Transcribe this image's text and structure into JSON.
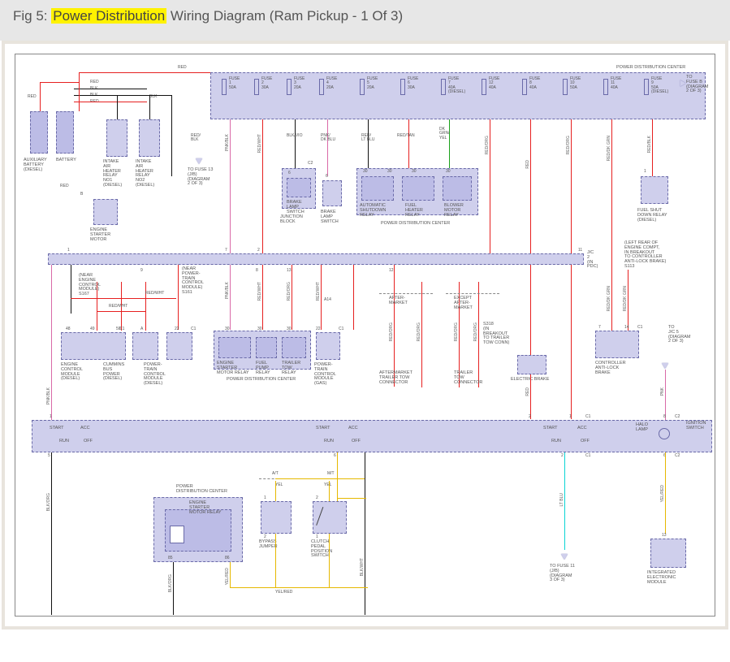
{
  "header": {
    "prefix": "Fig 5: ",
    "highlight": "Power Distribution",
    "suffix": " Wiring Diagram (Ram Pickup - 1 Of 3)"
  },
  "title_pdc": "POWER DISTRIBUTION CENTER",
  "to_fuse_b": "TO\nFUSE B\n(DIAGRAM\n2 OF 3)",
  "fuses": [
    {
      "n": "FUSE\n1",
      "a": "50A"
    },
    {
      "n": "FUSE\n2",
      "a": "30A"
    },
    {
      "n": "FUSE\n3",
      "a": "20A"
    },
    {
      "n": "FUSE\n4",
      "a": "20A"
    },
    {
      "n": "FUSE\n5",
      "a": "20A"
    },
    {
      "n": "FUSE\n6",
      "a": "30A"
    },
    {
      "n": "FUSE\n7",
      "a": "40A\n(DIESEL)"
    },
    {
      "n": "FUSE\n12",
      "a": "40A"
    },
    {
      "n": "FUSE\n8",
      "a": "40A"
    },
    {
      "n": "FUSE\n10",
      "a": "50A"
    },
    {
      "n": "FUSE\n11",
      "a": "40A"
    },
    {
      "n": "FUSE\n9",
      "a": "50A\n(DIESEL)"
    }
  ],
  "batteries": {
    "aux": "AUXILIARY\nBATTERY\n(DIESEL)",
    "main": "BATTERY"
  },
  "relays_top": {
    "ih1": "INTAKE\nAIR\nHEATER\nRELAY\nNO1\n(DIESEL)",
    "ih2": "INTAKE\nAIR\nHEATER\nRELAY\nNO2\n(DIESEL)",
    "starter": "ENGINE\nSTARTER\nMOTOR",
    "to_fuse13": "TO FUSE 13\n(J/B)\n(DIAGRAM\n2 OF 3)",
    "brake_lamp_sw": "BRAKE\nLAMP\nSWITCH",
    "junction_block": "JUNCTION\nBLOCK",
    "brake_lamp_sw2": "BRAKE\nLAMP\nSWITCH",
    "auto_shutdown": "AUTOMATIC\nSHUTDOWN\nRELAY",
    "fuel_heater": "FUEL\nHEATER\nRELAY",
    "blower": "BLOWER\nMOTOR\nRELAY",
    "pdc2": "POWER DISTRIBUTION CENTER",
    "fuel_shutdown": "FUEL SHUT\nDOWN RELAY\n(DIESEL)"
  },
  "wire_colors": {
    "red": "RED",
    "blk": "BLK",
    "red_blk": "RED/\nBLK",
    "pnk_blk": "PNK/BLK",
    "red_wht": "RED/WHT",
    "blk_vio": "BLK/VIO",
    "pnk_dkblu": "PNK/\nDK BLU",
    "red_ltblu": "RED/\nLT BLU",
    "red_tan": "RED/TAN",
    "dk_grn_yel": "DK\nGRN/\nYEL",
    "red_org": "RED/ORG",
    "red_dkgrn": "RED/DK GRN",
    "red_blk2": "RED/BLK",
    "blk_org": "BLK/ORG",
    "blk_wht": "BLK/WHT",
    "lt_blu": "LT BLU",
    "pnk": "PNK",
    "yel_red": "YEL/RED",
    "yel": "YEL"
  },
  "jc2": "J/C\n2\n(IN\nPDC)",
  "note_s113": "(LEFT REAR OF\nENGINE COMPT,\nIN BREAKOUT\nTO CONTROLLER\nANTI-LOCK BRAKE)\nS113",
  "mid_notes": {
    "s167": "(NEAR\nENGINE\nCONTROL\nMODULE)\nS167",
    "s161": "(NEAR\nPOWER-\nTRAIN\nCONTROL\nMODULE)\nS161",
    "a14": "A14",
    "after": "AFTER-\nMARKET",
    "except": "EXCEPT\nAFTER-\nMARKET",
    "s318": "S318\n(IN\nBREAKOUT\nTO TRAILER\nTOW CONN)"
  },
  "mid_row": {
    "ecm": "ENGINE\nCONTROL\nMODULE\n(DIESEL)",
    "cummins": "CUMMINS\nBUS\nPOWER\n(DIESEL)",
    "ptcm_d": "POWER-\nTRAIN\nCONTROL\nMODULE\n(DIESEL)",
    "starter_relay": "ENGINE\nSTARTER\nMOTOR RELAY",
    "fuel_pump": "FUEL\nPUMP\nRELAY",
    "trailer_tow": "TRAILER\nTOW\nRELAY",
    "pdc3": "POWER DISTRIBUTION CENTER",
    "ptcm_g": "POWER-\nTRAIN\nCONTROL\nMODULE\n(GAS)",
    "aft_conn": "AFTERMARKET\nTRAILER TOW\nCONNECTOR",
    "trailer_conn": "TRAILER\nTOW\nCONNECTOR",
    "ebrake": "ELECTRIC BRAKE",
    "cab": "CONTROLLER\nANTI-LOCK\nBRAKE",
    "to_jc5": "TO\nJ/C 5\n(DIAGRAM\n2 OF 3)"
  },
  "ign": {
    "start": "START",
    "run": "RUN",
    "off": "OFF",
    "acc": "ACC",
    "halo": "HALO\nLAMP",
    "label": "IGNITION\nSWITCH"
  },
  "bottom": {
    "pdc4": "POWER\nDISTRIBUTION CENTER",
    "esmr": "ENGINE\nSTARTER\nMOTOR RELAY",
    "bypass": "BYPASS\nJUMPER",
    "clutch": "CLUTCH\nPEDAL\nPOSITION\nSWITCH",
    "at": "A/T",
    "mt": "M/T",
    "to_fuse11": "TO FUSE 11\n(J/B)\n(DIAGRAM\n3 OF 3)",
    "iem": "INTEGRATED\nELECTRONIC\nMODULE"
  },
  "pins": {
    "p1": "1",
    "p2": "2",
    "p5": "5",
    "p6": "6",
    "p7": "7",
    "p8": "8",
    "p9": "9",
    "p11": "11",
    "p12": "12",
    "p13": "13",
    "p14": "14",
    "p22": "22",
    "p30": "30",
    "p48": "48",
    "p49": "49",
    "p50": "50",
    "p85": "85",
    "p86": "86",
    "c1": "C1",
    "c2": "C2",
    "a": "A",
    "b": "B"
  }
}
